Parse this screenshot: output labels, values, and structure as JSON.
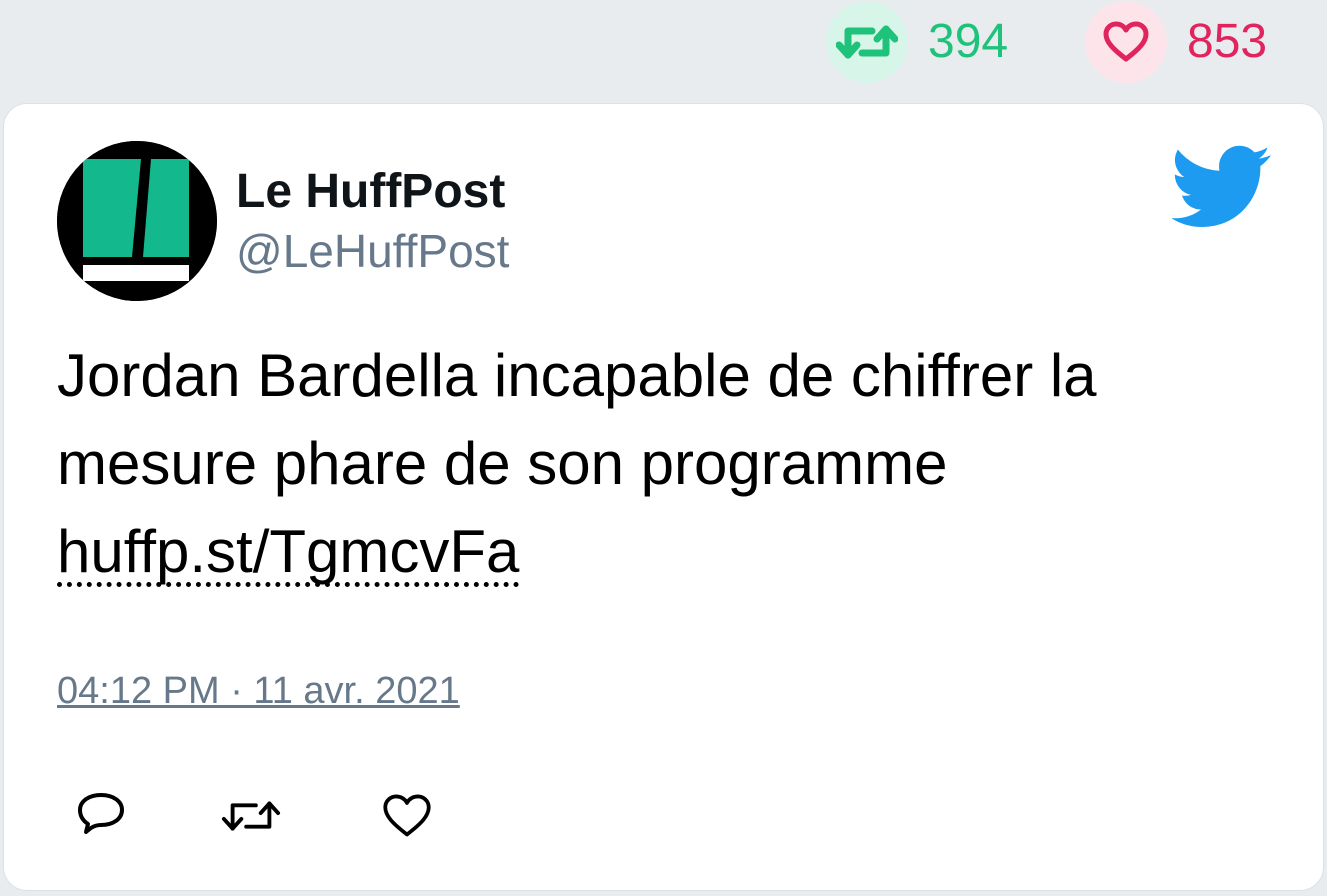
{
  "stats": {
    "retweet_icon": "retweet-icon",
    "retweet_count": "394",
    "retweet_color": "#1ec27a",
    "like_icon": "heart-icon",
    "like_count": "853",
    "like_color": "#e0245e"
  },
  "tweet": {
    "avatar_icon": "huffpost-logo",
    "author_name": "Le HuffPost",
    "author_handle": "@LeHuffPost",
    "platform_icon": "twitter-bird-icon",
    "platform_color": "#1d9bf0",
    "text_line1": "Jordan Bardella incapable de chiffrer la",
    "text_line2": "mesure phare de son programme",
    "link": "huffp.st/TgmcvFa",
    "timestamp": "04:12 PM · 11 avr. 2021"
  },
  "actions": {
    "reply_icon": "reply-icon",
    "retweet_icon": "retweet-icon",
    "like_icon": "heart-icon"
  }
}
